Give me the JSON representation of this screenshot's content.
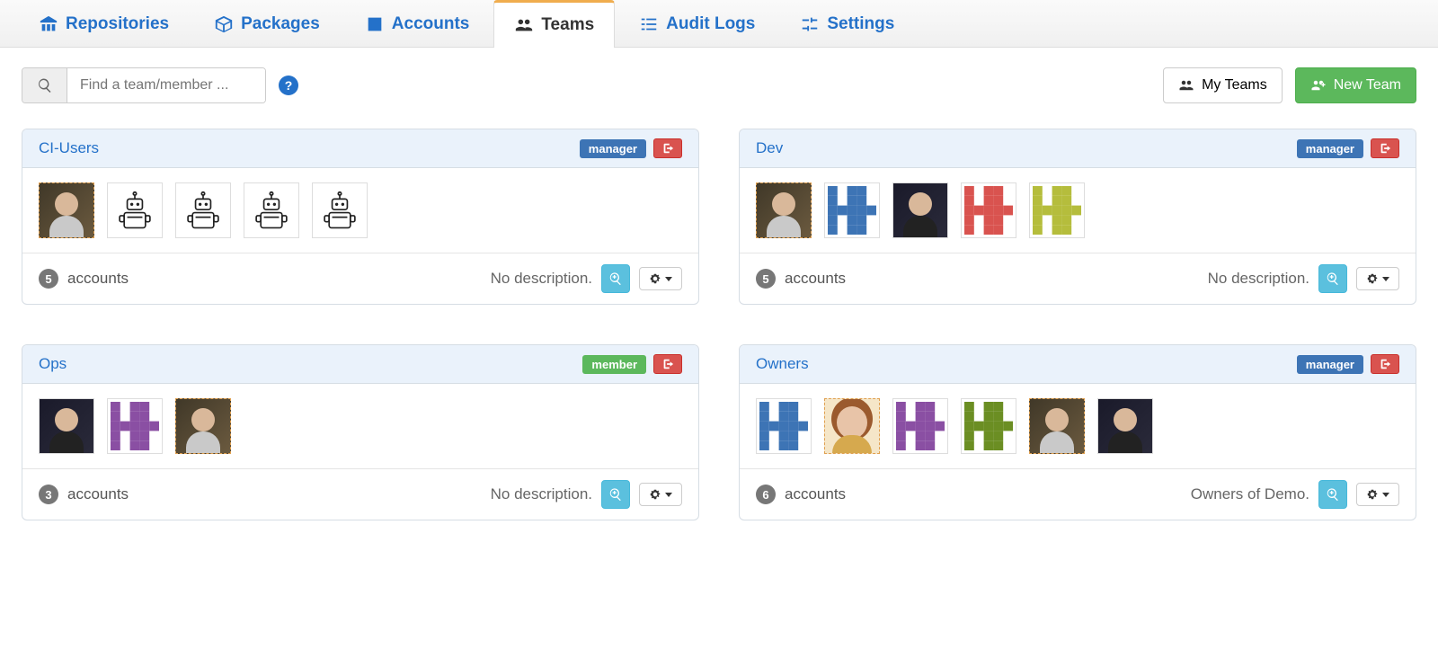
{
  "tabs": [
    {
      "label": "Repositories",
      "icon": "warehouse"
    },
    {
      "label": "Packages",
      "icon": "box"
    },
    {
      "label": "Accounts",
      "icon": "id"
    },
    {
      "label": "Teams",
      "icon": "users",
      "active": true
    },
    {
      "label": "Audit Logs",
      "icon": "list"
    },
    {
      "label": "Settings",
      "icon": "sliders"
    }
  ],
  "search": {
    "placeholder": "Find a team/member ..."
  },
  "buttons": {
    "my_teams": "My Teams",
    "new_team": "New Team"
  },
  "labels": {
    "accounts": "accounts",
    "no_description": "No description."
  },
  "teams": [
    {
      "name": "CI-Users",
      "role": "manager",
      "count": "5",
      "description": "No description.",
      "avatars": [
        {
          "type": "photo"
        },
        {
          "type": "robot"
        },
        {
          "type": "robot"
        },
        {
          "type": "robot"
        },
        {
          "type": "robot"
        }
      ]
    },
    {
      "name": "Dev",
      "role": "manager",
      "count": "5",
      "description": "No description.",
      "avatars": [
        {
          "type": "photo"
        },
        {
          "type": "identicon",
          "color": "#3d74b5"
        },
        {
          "type": "photo2"
        },
        {
          "type": "identicon",
          "color": "#d9534f"
        },
        {
          "type": "identicon",
          "color": "#b5bd3c"
        }
      ]
    },
    {
      "name": "Ops",
      "role": "member",
      "count": "3",
      "description": "No description.",
      "avatars": [
        {
          "type": "photo2"
        },
        {
          "type": "identicon",
          "color": "#8a4fa3"
        },
        {
          "type": "photo"
        }
      ]
    },
    {
      "name": "Owners",
      "role": "manager",
      "count": "6",
      "description": "Owners of Demo.",
      "avatars": [
        {
          "type": "identicon",
          "color": "#3d74b5"
        },
        {
          "type": "photo3"
        },
        {
          "type": "identicon",
          "color": "#8a4fa3"
        },
        {
          "type": "identicon",
          "color": "#6b8e23"
        },
        {
          "type": "photo"
        },
        {
          "type": "photo2"
        }
      ]
    }
  ]
}
